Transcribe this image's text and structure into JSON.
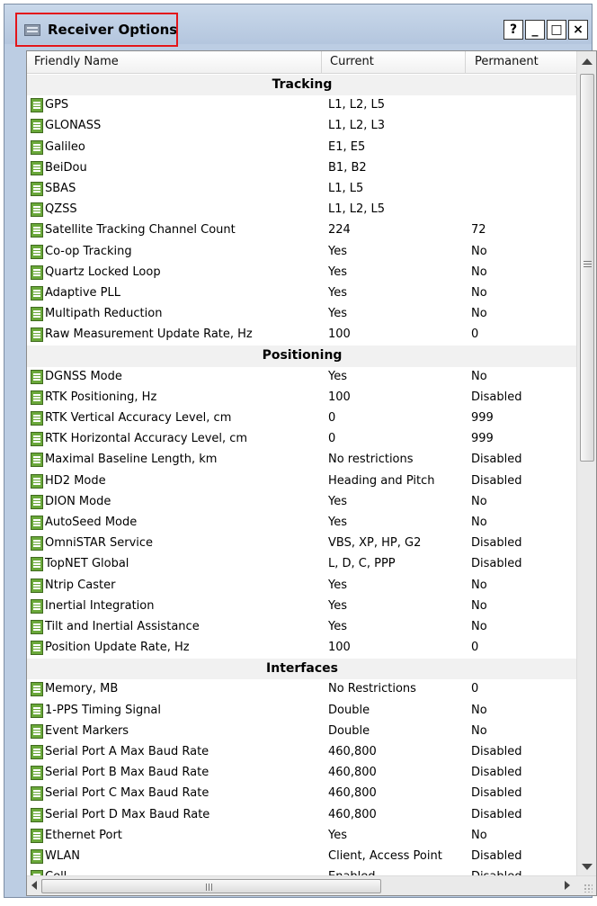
{
  "window": {
    "title": "Receiver Options",
    "buttons": [
      "?",
      "_",
      "□",
      "×"
    ]
  },
  "columns": {
    "name": "Friendly Name",
    "current": "Current",
    "permanent": "Permanent"
  },
  "sections": [
    {
      "title": "Tracking",
      "rows": [
        {
          "name": "GPS",
          "current": "L1, L2, L5",
          "permanent": ""
        },
        {
          "name": "GLONASS",
          "current": "L1, L2, L3",
          "permanent": ""
        },
        {
          "name": "Galileo",
          "current": "E1, E5",
          "permanent": ""
        },
        {
          "name": "BeiDou",
          "current": "B1, B2",
          "permanent": ""
        },
        {
          "name": "SBAS",
          "current": "L1, L5",
          "permanent": ""
        },
        {
          "name": "QZSS",
          "current": "L1, L2, L5",
          "permanent": ""
        },
        {
          "name": "Satellite Tracking Channel Count",
          "current": "224",
          "permanent": "72"
        },
        {
          "name": "Co-op Tracking",
          "current": "Yes",
          "permanent": "No"
        },
        {
          "name": "Quartz Locked Loop",
          "current": "Yes",
          "permanent": "No"
        },
        {
          "name": "Adaptive PLL",
          "current": "Yes",
          "permanent": "No"
        },
        {
          "name": "Multipath Reduction",
          "current": "Yes",
          "permanent": "No"
        },
        {
          "name": "Raw Measurement Update Rate, Hz",
          "current": "100",
          "permanent": "0"
        }
      ]
    },
    {
      "title": "Positioning",
      "rows": [
        {
          "name": "DGNSS Mode",
          "current": "Yes",
          "permanent": "No"
        },
        {
          "name": "RTK Positioning, Hz",
          "current": "100",
          "permanent": "Disabled"
        },
        {
          "name": "RTK Vertical Accuracy Level, cm",
          "current": "0",
          "permanent": "999"
        },
        {
          "name": "RTK Horizontal Accuracy Level, cm",
          "current": "0",
          "permanent": "999"
        },
        {
          "name": "Maximal Baseline Length, km",
          "current": "No restrictions",
          "permanent": "Disabled"
        },
        {
          "name": "HD2 Mode",
          "current": "Heading and Pitch",
          "permanent": "Disabled"
        },
        {
          "name": "DION Mode",
          "current": "Yes",
          "permanent": "No"
        },
        {
          "name": "AutoSeed Mode",
          "current": "Yes",
          "permanent": "No"
        },
        {
          "name": "OmniSTAR Service",
          "current": "VBS, XP, HP, G2",
          "permanent": "Disabled"
        },
        {
          "name": "TopNET Global",
          "current": "L, D, C, PPP",
          "permanent": "Disabled"
        },
        {
          "name": "Ntrip Caster",
          "current": "Yes",
          "permanent": "No"
        },
        {
          "name": "Inertial Integration",
          "current": "Yes",
          "permanent": "No"
        },
        {
          "name": "Tilt and Inertial Assistance",
          "current": "Yes",
          "permanent": "No"
        },
        {
          "name": "Position Update Rate, Hz",
          "current": "100",
          "permanent": "0"
        }
      ]
    },
    {
      "title": "Interfaces",
      "rows": [
        {
          "name": "Memory, MB",
          "current": "No Restrictions",
          "permanent": "0"
        },
        {
          "name": "1-PPS Timing Signal",
          "current": "Double",
          "permanent": "No"
        },
        {
          "name": "Event Markers",
          "current": "Double",
          "permanent": "No"
        },
        {
          "name": "Serial Port A Max Baud Rate",
          "current": "460,800",
          "permanent": "Disabled"
        },
        {
          "name": "Serial Port B Max Baud Rate",
          "current": "460,800",
          "permanent": "Disabled"
        },
        {
          "name": "Serial Port C Max Baud Rate",
          "current": "460,800",
          "permanent": "Disabled"
        },
        {
          "name": "Serial Port D Max Baud Rate",
          "current": "460,800",
          "permanent": "Disabled"
        },
        {
          "name": "Ethernet Port",
          "current": "Yes",
          "permanent": "No"
        },
        {
          "name": "WLAN",
          "current": "Client, Access Point",
          "permanent": "Disabled"
        },
        {
          "name": "Cell",
          "current": "Enabled",
          "permanent": "Disabled"
        }
      ]
    }
  ],
  "scrollbar": {
    "grip": "III"
  },
  "colors": {
    "highlight": "#e3151a",
    "icon": "#6aa83a"
  }
}
